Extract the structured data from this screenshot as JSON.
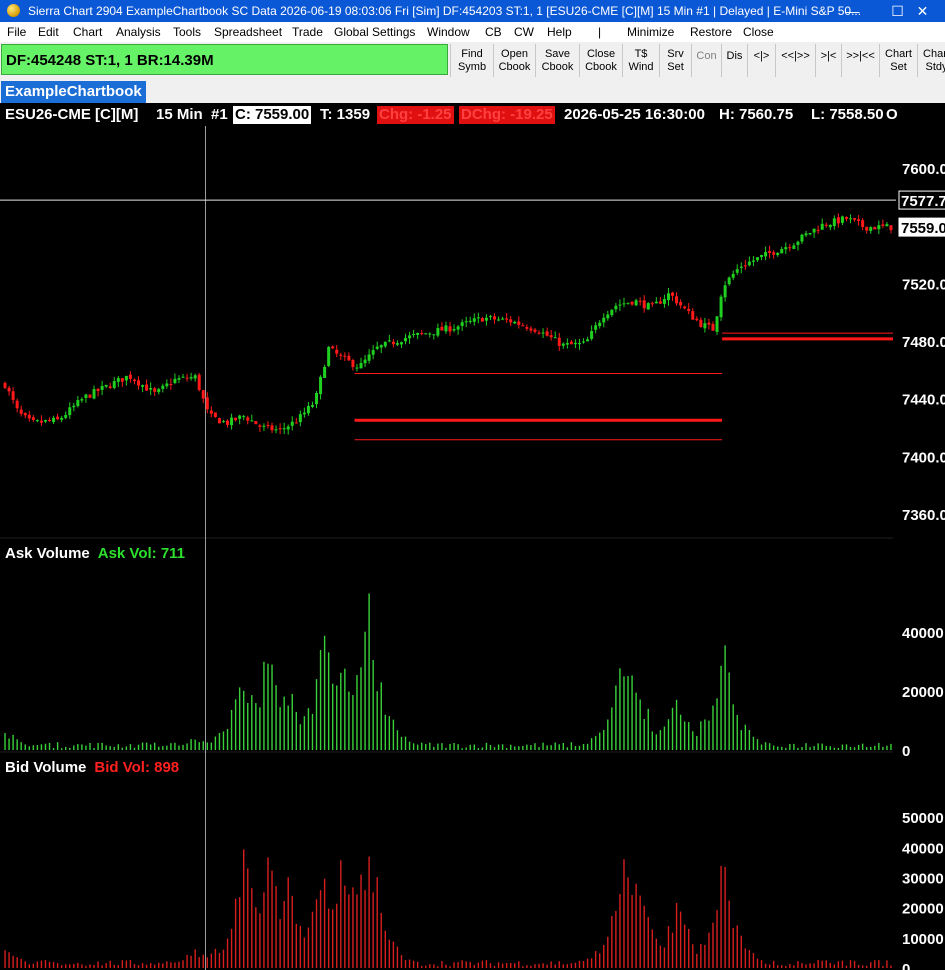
{
  "window": {
    "title": "Sierra Chart 2904 ExampleChartbook SC Data 2026-06-19  08:03:06 Fri [Sim] DF:454203  ST:1, 1 [ESU26-CME [C][M]  15 Min  #1 | Delayed | E-Mini S&P 50...",
    "minimize_glyph": "—",
    "maximize_glyph": "☐",
    "close_glyph": "✕"
  },
  "menu": [
    "File",
    "Edit",
    "Chart",
    "Analysis",
    "Tools",
    "Spreadsheet",
    "Trade",
    "Global Settings",
    "Window",
    "CB",
    "CW",
    "Help",
    "|",
    "Minimize",
    "Restore",
    "Close"
  ],
  "toolbar": {
    "status_text": "DF:454248  ST:1, 1  BR:14.39M",
    "buttons": [
      {
        "label": "Find\nSymb",
        "enabled": true
      },
      {
        "label": "Open\nCbook",
        "enabled": true
      },
      {
        "label": "Save\nCbook",
        "enabled": true
      },
      {
        "label": "Close\nCbook",
        "enabled": true
      },
      {
        "label": "T$\nWind",
        "enabled": true
      },
      {
        "label": "Srv\nSet",
        "enabled": true
      },
      {
        "label": "Con",
        "enabled": false
      },
      {
        "label": "Dis",
        "enabled": true
      },
      {
        "label": "<|>",
        "enabled": true
      },
      {
        "label": "<<|>>",
        "enabled": true
      },
      {
        "label": ">|<",
        "enabled": true
      },
      {
        "label": ">>|<<",
        "enabled": true
      },
      {
        "label": "Chart\nSet",
        "enabled": true
      },
      {
        "label": "Chart\nStdy",
        "enabled": true
      }
    ]
  },
  "tabs": [
    {
      "label": "ExampleChartbook",
      "active": true
    }
  ],
  "chart_header": {
    "symbol": "ESU26-CME [C][M]",
    "interval": "15 Min",
    "chart_number": "#1",
    "close_text": "C: 7559.00",
    "trades_text": "T: 1359",
    "chg_text": "Chg: -1.25",
    "dchg_text": "DChg: -19.25",
    "datetime_text": "2026-05-25 16:30:00",
    "high_text": "H: 7560.75",
    "low_text": "L: 7558.50",
    "trailing_text": "O"
  },
  "colors": {
    "up": "#20d020",
    "down": "#ff1a1a",
    "ask_volume": "#39d03a",
    "bid_volume": "#d61e1e",
    "level_line": "#ff1a1a",
    "status_green": "#66f266",
    "title_blue": "#0a58d6"
  },
  "chart_data": [
    {
      "type": "candlestick",
      "title": "",
      "y_ticks": [
        7600,
        7560,
        7520,
        7480,
        7440,
        7400,
        7360
      ],
      "y_tick_labels": [
        "7600.0",
        "7560.0",
        "7520.0",
        "7480.0",
        "7440.0",
        "7400.0",
        "7360.0"
      ],
      "ylim": [
        7342,
        7620
      ],
      "price_labels": [
        {
          "text": "7577.7",
          "value": 7577.75,
          "style": "crosshair"
        },
        {
          "text": "7559.0",
          "value": 7559.0,
          "style": "last"
        }
      ],
      "crosshair_price": 7577.75,
      "level_lines": [
        {
          "value": 7485.5,
          "from_bar": 0.808,
          "to_bar": 1.0,
          "thickness": 1
        },
        {
          "value": 7481.5,
          "from_bar": 0.808,
          "to_bar": 1.0,
          "thickness": 3
        },
        {
          "value": 7457.5,
          "from_bar": 0.395,
          "to_bar": 0.808,
          "thickness": 1
        },
        {
          "value": 7425.0,
          "from_bar": 0.395,
          "to_bar": 0.808,
          "thickness": 3
        },
        {
          "value": 7411.5,
          "from_bar": 0.395,
          "to_bar": 0.808,
          "thickness": 1
        }
      ],
      "close_path_keypoints": [
        [
          0,
          7450
        ],
        [
          0.015,
          7430
        ],
        [
          0.03,
          7423
        ],
        [
          0.06,
          7425
        ],
        [
          0.09,
          7441
        ],
        [
          0.12,
          7450
        ],
        [
          0.14,
          7456
        ],
        [
          0.17,
          7443
        ],
        [
          0.19,
          7453
        ],
        [
          0.215,
          7455
        ],
        [
          0.23,
          7428
        ],
        [
          0.25,
          7423
        ],
        [
          0.27,
          7428
        ],
        [
          0.29,
          7420
        ],
        [
          0.31,
          7418
        ],
        [
          0.33,
          7425
        ],
        [
          0.35,
          7438
        ],
        [
          0.365,
          7475
        ],
        [
          0.38,
          7468
        ],
        [
          0.4,
          7462
        ],
        [
          0.42,
          7475
        ],
        [
          0.45,
          7482
        ],
        [
          0.48,
          7486
        ],
        [
          0.51,
          7490
        ],
        [
          0.54,
          7496
        ],
        [
          0.57,
          7494
        ],
        [
          0.6,
          7488
        ],
        [
          0.63,
          7477
        ],
        [
          0.655,
          7478
        ],
        [
          0.675,
          7498
        ],
        [
          0.69,
          7505
        ],
        [
          0.71,
          7508
        ],
        [
          0.73,
          7503
        ],
        [
          0.75,
          7513
        ],
        [
          0.77,
          7500
        ],
        [
          0.785,
          7492
        ],
        [
          0.8,
          7488
        ],
        [
          0.81,
          7518
        ],
        [
          0.83,
          7532
        ],
        [
          0.86,
          7540
        ],
        [
          0.89,
          7548
        ],
        [
          0.92,
          7560
        ],
        [
          0.95,
          7565
        ],
        [
          0.97,
          7559
        ],
        [
          1.0,
          7559
        ]
      ]
    },
    {
      "type": "bar",
      "title": "Ask Volume",
      "value_label": "Ask Vol: 711",
      "y_ticks": [
        40000,
        20000,
        0
      ],
      "y_tick_labels": [
        "40000",
        "20000",
        "0"
      ],
      "ylim": [
        0,
        57000
      ],
      "spikes": [
        {
          "at": 0.0,
          "value": 9000
        },
        {
          "at": 0.215,
          "value": 6000
        },
        {
          "at": 0.27,
          "value": 33000
        },
        {
          "at": 0.3,
          "value": 48000
        },
        {
          "at": 0.32,
          "value": 28000
        },
        {
          "at": 0.36,
          "value": 46000
        },
        {
          "at": 0.38,
          "value": 36000
        },
        {
          "at": 0.39,
          "value": 30000
        },
        {
          "at": 0.41,
          "value": 57000
        },
        {
          "at": 0.7,
          "value": 43000
        },
        {
          "at": 0.715,
          "value": 28000
        },
        {
          "at": 0.76,
          "value": 25000
        },
        {
          "at": 0.81,
          "value": 43000
        },
        {
          "at": 0.92,
          "value": 3000
        }
      ],
      "base_value": 1500
    },
    {
      "type": "bar",
      "title": "Bid Volume",
      "value_label": "Bid Vol: 898",
      "y_ticks": [
        50000,
        40000,
        30000,
        20000,
        10000,
        0
      ],
      "y_tick_labels": [
        "50000",
        "40000",
        "30000",
        "20000",
        "10000",
        "0"
      ],
      "ylim": [
        0,
        57000
      ],
      "spikes": [
        {
          "at": 0.0,
          "value": 10000
        },
        {
          "at": 0.215,
          "value": 8000
        },
        {
          "at": 0.27,
          "value": 45000
        },
        {
          "at": 0.3,
          "value": 46000
        },
        {
          "at": 0.32,
          "value": 33000
        },
        {
          "at": 0.36,
          "value": 41000
        },
        {
          "at": 0.38,
          "value": 38000
        },
        {
          "at": 0.39,
          "value": 36000
        },
        {
          "at": 0.41,
          "value": 56000
        },
        {
          "at": 0.7,
          "value": 43000
        },
        {
          "at": 0.715,
          "value": 34000
        },
        {
          "at": 0.76,
          "value": 28000
        },
        {
          "at": 0.81,
          "value": 40000
        },
        {
          "at": 0.92,
          "value": 4000
        }
      ],
      "base_value": 1500
    }
  ]
}
